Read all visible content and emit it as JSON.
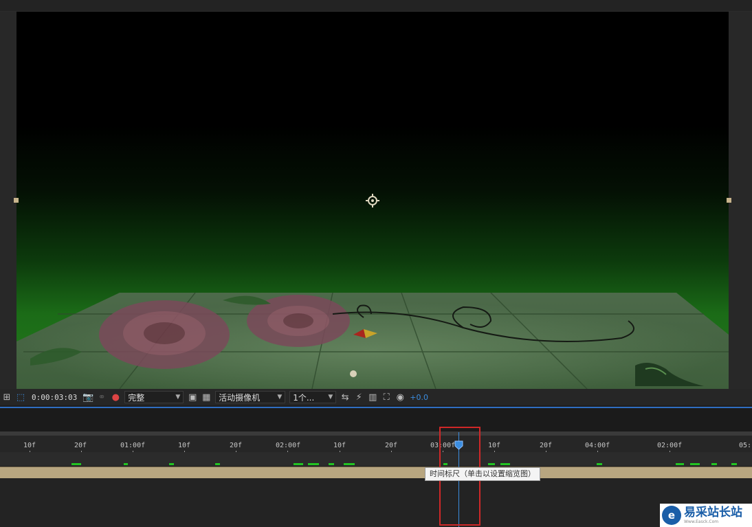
{
  "toolbar": {
    "timecode": "0:00:03:03",
    "resolution": "完整",
    "camera": "活动摄像机",
    "views": "1个...",
    "exposure": "+0.0"
  },
  "ruler": {
    "ticks": [
      "10f",
      "20f",
      "01:00f",
      "10f",
      "20f",
      "02:00f",
      "10f",
      "20f",
      "03:00f",
      "10f",
      "20f",
      "04:00f",
      "02:00f",
      "05:"
    ]
  },
  "tooltip": "时间标尺（单击以设置缩览图）",
  "watermark": {
    "title": "易采站长站",
    "url": "Www.Easck.Com"
  },
  "colors": {
    "accent": "#3b8de0",
    "marker": "#22c322",
    "highlight": "#d02828",
    "layer_bar": "#b8a680"
  }
}
